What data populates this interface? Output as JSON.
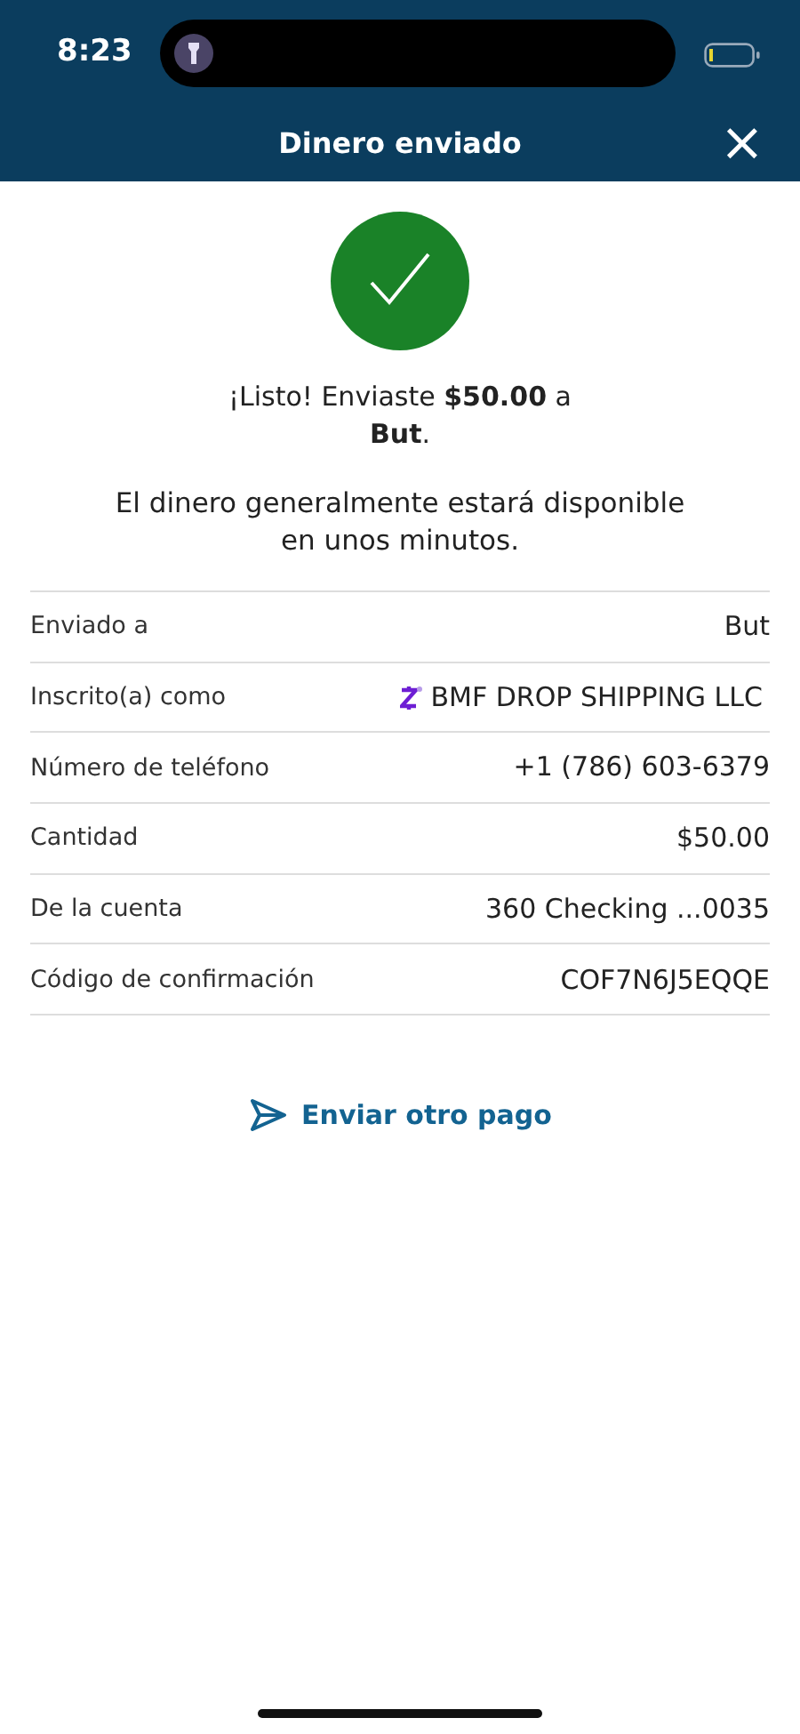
{
  "status_bar": {
    "time": "8:23"
  },
  "header": {
    "title": "Dinero enviado",
    "close": "×"
  },
  "message": "¡Listo! Enviaste **$50.00** a\n**But**.",
  "note": "El dinero generalmente estará disponible\nen unos minutos.",
  "details": [
    {
      "label": "Enviado a",
      "value": "But",
      "kind": "plain"
    },
    {
      "label": "Inscrito(a) como",
      "value": "BMF DROP SHIPPING LLC",
      "kind": "zelle"
    },
    {
      "label": "Número de teléfono",
      "value": "+1 (786) 603-6379",
      "kind": "plain"
    },
    {
      "label": "Cantidad",
      "value": "$50.00",
      "kind": "plain"
    },
    {
      "label": "De la cuenta",
      "value": "360 Checking ...0035",
      "kind": "plain"
    },
    {
      "label": "Código de confirmación",
      "value": "COF7N6J5EQQE",
      "kind": "plain"
    }
  ],
  "action": {
    "label": "Enviar otro pago"
  }
}
